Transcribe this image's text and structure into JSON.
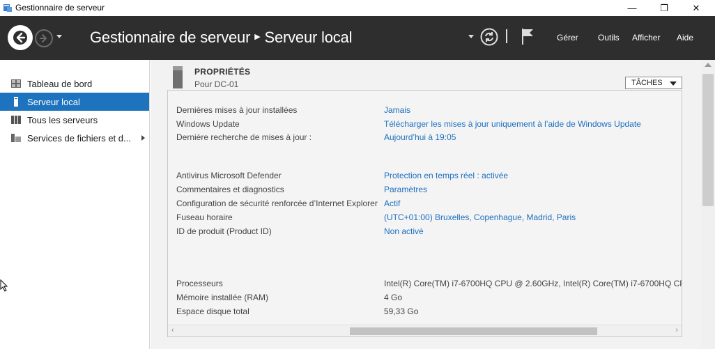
{
  "window": {
    "title": "Gestionnaire de serveur",
    "controls": {
      "minimize": "—",
      "maximize": "❐",
      "close": "✕"
    }
  },
  "header": {
    "breadcrumb_root": "Gestionnaire de serveur",
    "breadcrumb_separator": "▶",
    "breadcrumb_current": "Serveur local",
    "menus": {
      "gerer": "Gérer",
      "outils": "Outils",
      "afficher": "Afficher",
      "aide": "Aide"
    },
    "icons": [
      "back-icon",
      "forward-icon",
      "dropdown-icon",
      "refresh-icon",
      "flag-icon"
    ]
  },
  "sidebar": {
    "items": [
      {
        "label": "Tableau de bord",
        "icon": "dashboard-icon",
        "active": false
      },
      {
        "label": "Serveur local",
        "icon": "local-server-icon",
        "active": true
      },
      {
        "label": "Tous les serveurs",
        "icon": "all-servers-icon",
        "active": false
      },
      {
        "label": "Services de fichiers et d...",
        "icon": "file-services-icon",
        "active": false,
        "expandable": true
      }
    ]
  },
  "properties": {
    "title": "PROPRIÉTÉS",
    "subtitle": "Pour DC-01",
    "tasks_label": "TÂCHES",
    "rows": [
      {
        "label": "Dernières mises à jour installées",
        "value": "Jamais",
        "link": true
      },
      {
        "label": "Windows Update",
        "value": "Télécharger les mises à jour uniquement à l’aide de Windows Update",
        "link": true
      },
      {
        "label": "Dernière recherche de mises à jour :",
        "value": "Aujourd’hui à 19:05",
        "link": true
      },
      {
        "label": "Antivirus Microsoft Defender",
        "value": "Protection en temps réel : activée",
        "link": true
      },
      {
        "label": "Commentaires et diagnostics",
        "value": "Paramètres",
        "link": true
      },
      {
        "label": "Configuration de sécurité renforcée d’Internet Explorer",
        "value": "Actif",
        "link": true
      },
      {
        "label": "Fuseau horaire",
        "value": "(UTC+01:00) Bruxelles, Copenhague, Madrid, Paris",
        "link": true
      },
      {
        "label": "ID de produit (Product ID)",
        "value": "Non activé",
        "link": true
      },
      {
        "label": "Processeurs",
        "value": "Intel(R) Core(TM) i7-6700HQ CPU @ 2.60GHz, Intel(R) Core(TM) i7-6700HQ CPU @",
        "link": false
      },
      {
        "label": "Mémoire installée (RAM)",
        "value": "4 Go",
        "link": false
      },
      {
        "label": "Espace disque total",
        "value": "59,33 Go",
        "link": false
      }
    ]
  },
  "colors": {
    "header_bg": "#2e2e2e",
    "active_item": "#1e73be",
    "link": "#1e6fbf",
    "main_bg": "#f2f2f2"
  }
}
